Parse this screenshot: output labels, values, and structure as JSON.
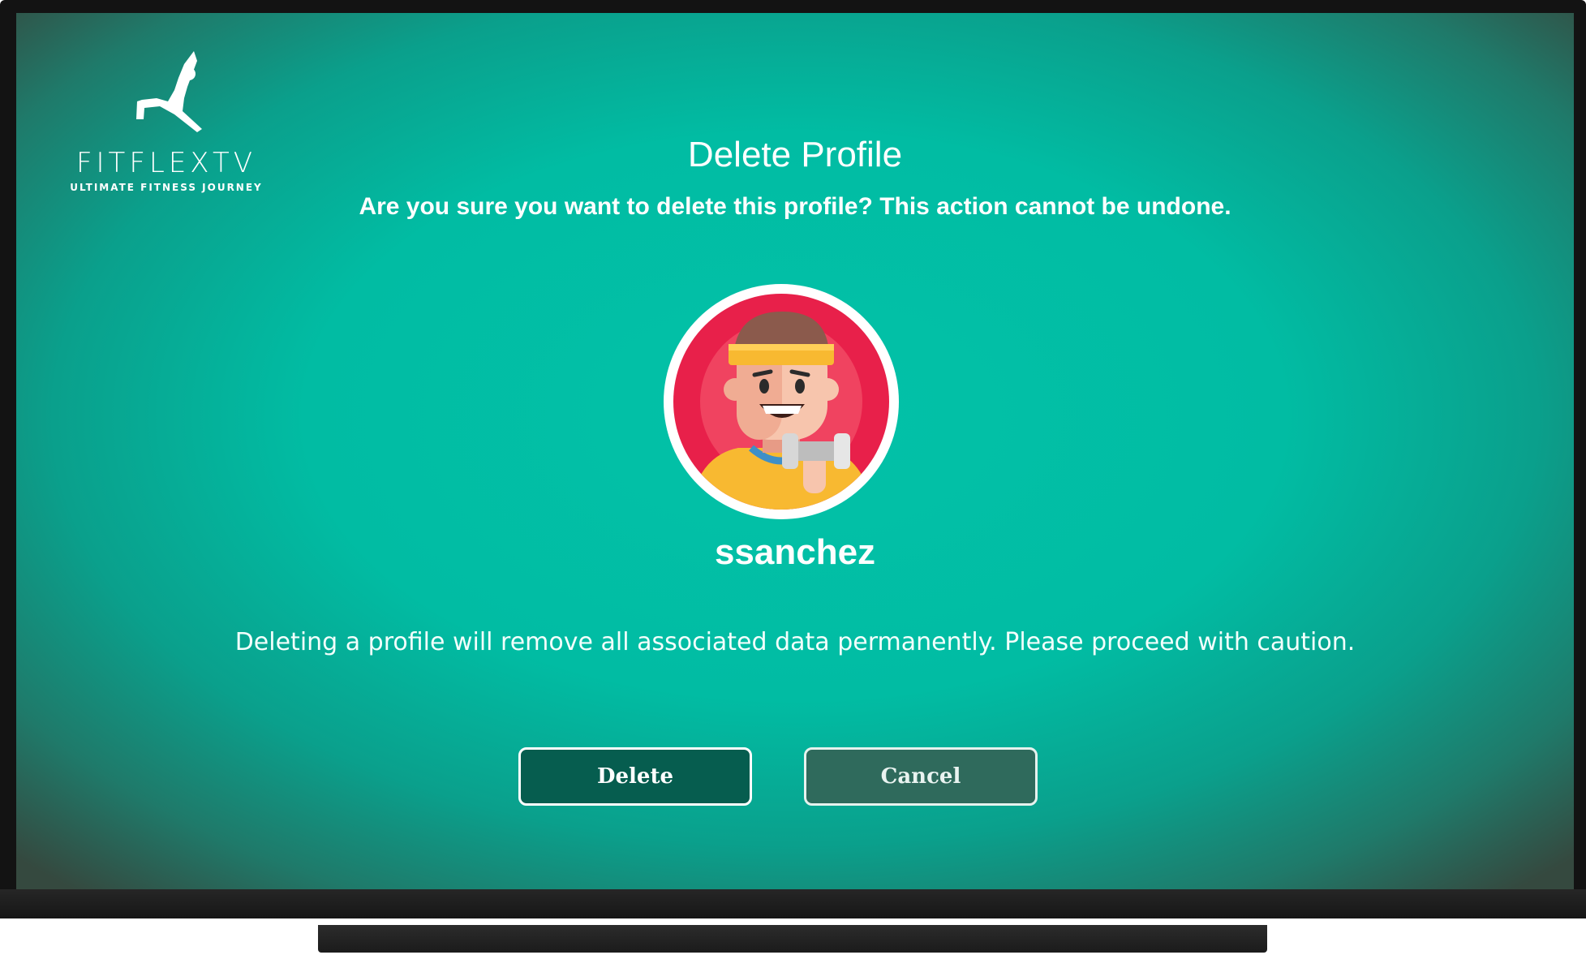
{
  "logo": {
    "name": "FITFLEXTV",
    "tagline": "ULTIMATE FITNESS JOURNEY",
    "icon": "yoga-figure-icon"
  },
  "dialog": {
    "title": "Delete Profile",
    "subtitle": "Are you sure you want to delete this profile? This action cannot be undone.",
    "username": "ssanchez",
    "warning": "Deleting a profile will remove all associated data permanently. Please proceed with caution."
  },
  "buttons": {
    "delete_label": "Delete",
    "cancel_label": "Cancel"
  },
  "colors": {
    "screen_accent": "#01bca3",
    "delete_button": "#065d4f",
    "cancel_button": "#2f6a5c",
    "avatar_background": "#e8204a"
  }
}
